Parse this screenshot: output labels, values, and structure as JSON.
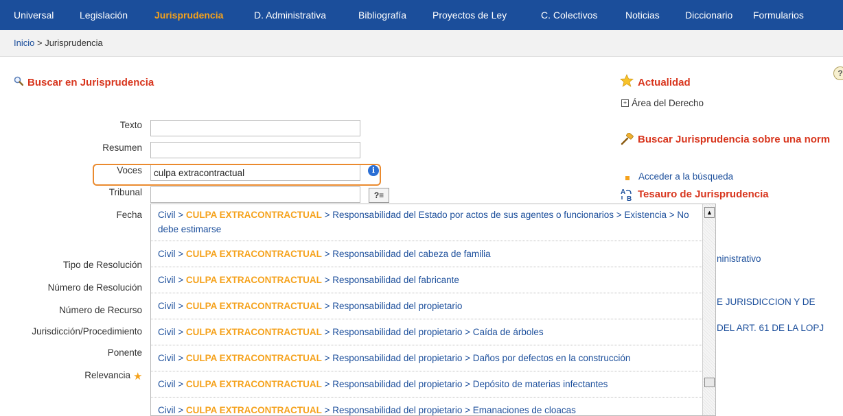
{
  "nav": {
    "items": [
      "Universal",
      "Legislación",
      "Jurisprudencia",
      "D. Administrativa",
      "Bibliografía",
      "Proyectos de Ley",
      "C. Colectivos",
      "Noticias",
      "Diccionario",
      "Formularios"
    ],
    "active": "Jurisprudencia"
  },
  "breadcrumb": {
    "home": "Inicio",
    "separator": ">",
    "current": "Jurisprudencia"
  },
  "search": {
    "title": "Buscar en Jurisprudencia",
    "labels": {
      "texto": "Texto",
      "resumen": "Resumen",
      "voces": "Voces",
      "tribunal": "Tribunal",
      "fecha": "Fecha",
      "tipo": "Tipo de Resolución",
      "numero_resolucion": "Número de Resolución",
      "numero_recurso": "Número de Recurso",
      "jurisdiccion": "Jurisdicción/Procedimiento",
      "ponente": "Ponente",
      "relevancia": "Relevancia"
    },
    "values": {
      "texto": "",
      "resumen": "",
      "voces": "culpa extracontractual",
      "tribunal": ""
    },
    "thesaurus_button": "?≡",
    "info_glyph": "i",
    "help_glyph": "?"
  },
  "right": {
    "actualidad_title": "Actualidad",
    "area_link": "Área del Derecho",
    "norma_title": "Buscar Jurisprudencia sobre una norm",
    "acceder_link": "Acceder a la búsqueda",
    "tesauro_title": "Tesauro de Jurisprudencia",
    "partial_1": "ninistrativo",
    "partial_2": "E JURISDICCION Y DE",
    "partial_3": "DEL ART. 61 DE LA LOPJ"
  },
  "autocomplete": {
    "prefix": "Civil > ",
    "keyword": "CULPA EXTRACONTRACTUAL",
    "items": [
      " > Responsabilidad del Estado por actos de sus agentes o funcionarios > Existencia > No debe estimarse",
      " > Responsabilidad del cabeza de familia",
      " > Responsabilidad del fabricante",
      " > Responsabilidad del propietario",
      " > Responsabilidad del propietario > Caída de árboles",
      " > Responsabilidad del propietario > Daños por defectos en la construcción",
      " > Responsabilidad del propietario > Depósito de materias infectantes",
      " > Responsabilidad del propietario > Emanaciones de cloacas"
    ]
  },
  "colors": {
    "nav_bg": "#1b4e9b",
    "accent": "#f5a21c",
    "title_red": "#d8361e",
    "highlight": "#ea8a2e"
  }
}
